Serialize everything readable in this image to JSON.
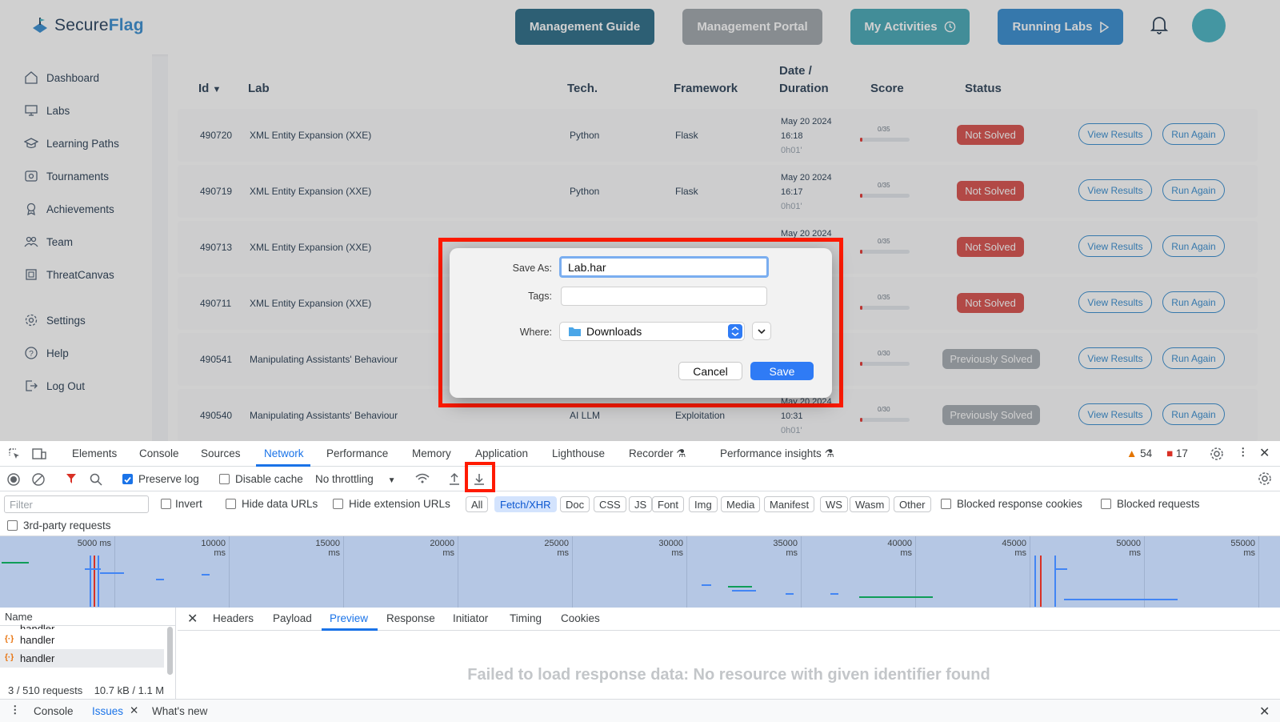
{
  "app": {
    "logo": {
      "part1": "Secure",
      "part2": "Flag"
    },
    "top_buttons": [
      {
        "label": "Management Guide",
        "color": "#2f6f8a"
      },
      {
        "label": "Management Portal",
        "color": "#a2a8ae"
      },
      {
        "label": "My Activities",
        "color": "#4aa9b8"
      },
      {
        "label": "Running Labs",
        "color": "#3a8fd1"
      }
    ],
    "sidebar": [
      {
        "label": "Dashboard",
        "icon": "home-icon"
      },
      {
        "label": "Labs",
        "icon": "monitor-icon"
      },
      {
        "label": "Learning Paths",
        "icon": "graduation-cap-icon"
      },
      {
        "label": "Tournaments",
        "icon": "tournament-icon"
      },
      {
        "label": "Achievements",
        "icon": "medal-icon"
      },
      {
        "label": "Team",
        "icon": "team-icon"
      },
      {
        "label": "ThreatCanvas",
        "icon": "canvas-icon"
      },
      {
        "label": "Settings",
        "icon": "gear-icon"
      },
      {
        "label": "Help",
        "icon": "help-icon"
      },
      {
        "label": "Log Out",
        "icon": "logout-icon"
      }
    ],
    "table": {
      "headers": {
        "id": "Id",
        "lab": "Lab",
        "tech": "Tech.",
        "framework": "Framework",
        "date1": "Date /",
        "date2": "Duration",
        "score": "Score",
        "status": "Status"
      },
      "view_results": "View Results",
      "run_again": "Run Again",
      "rows": [
        {
          "id": "490720",
          "lab": "XML Entity Expansion (XXE)",
          "tech": "Python",
          "framework": "Flask",
          "date": "May 20 2024",
          "time": "16:18",
          "duration": "0h01'",
          "score": "0/35",
          "status": "Not Solved",
          "status_kind": "red"
        },
        {
          "id": "490719",
          "lab": "XML Entity Expansion (XXE)",
          "tech": "Python",
          "framework": "Flask",
          "date": "May 20 2024",
          "time": "16:17",
          "duration": "0h01'",
          "score": "0/35",
          "status": "Not Solved",
          "status_kind": "red"
        },
        {
          "id": "490713",
          "lab": "XML Entity Expansion (XXE)",
          "tech": "",
          "framework": "",
          "date": "May 20 2024",
          "time": "",
          "duration": "",
          "score": "0/35",
          "status": "Not Solved",
          "status_kind": "red"
        },
        {
          "id": "490711",
          "lab": "XML Entity Expansion (XXE)",
          "tech": "",
          "framework": "",
          "date": "",
          "time": "",
          "duration": "",
          "score": "0/35",
          "status": "Not Solved",
          "status_kind": "red"
        },
        {
          "id": "490541",
          "lab": "Manipulating Assistants' Behaviour",
          "tech": "",
          "framework": "",
          "date": "",
          "time": "",
          "duration": "",
          "score": "0/30",
          "status": "Previously Solved",
          "status_kind": "grey"
        },
        {
          "id": "490540",
          "lab": "Manipulating Assistants' Behaviour",
          "tech": "AI LLM",
          "framework": "Exploitation",
          "date": "May 20 2024",
          "time": "10:31",
          "duration": "0h01'",
          "score": "0/30",
          "status": "Previously Solved",
          "status_kind": "grey"
        }
      ]
    }
  },
  "dialog": {
    "save_as_label": "Save As:",
    "save_as_value": "Lab.har",
    "tags_label": "Tags:",
    "where_label": "Where:",
    "where_value": "Downloads",
    "cancel": "Cancel",
    "save": "Save"
  },
  "devtools": {
    "tabs": [
      "Elements",
      "Console",
      "Sources",
      "Network",
      "Performance",
      "Memory",
      "Application",
      "Lighthouse",
      "Recorder",
      "Performance insights"
    ],
    "active_tab": "Network",
    "warnings": "54",
    "errors": "17",
    "toolbar": {
      "preserve_log": "Preserve log",
      "disable_cache": "Disable cache",
      "throttling": "No throttling"
    },
    "filter_placeholder": "Filter",
    "filter_checks": {
      "invert": "Invert",
      "hide_data": "Hide data URLs",
      "hide_ext": "Hide extension URLs",
      "blocked_cookies": "Blocked response cookies",
      "blocked_requests": "Blocked requests"
    },
    "chips": [
      "All",
      "Fetch/XHR",
      "Doc",
      "CSS",
      "JS",
      "Font",
      "Img",
      "Media",
      "Manifest",
      "WS",
      "Wasm",
      "Other"
    ],
    "selected_chip": "Fetch/XHR",
    "third_party": "3rd-party requests",
    "timeline_labels": [
      "5000 ms",
      "10000 ms",
      "15000 ms",
      "20000 ms",
      "25000 ms",
      "30000 ms",
      "35000 ms",
      "40000 ms",
      "45000 ms",
      "50000 ms",
      "55000 ms"
    ],
    "names_header": "Name",
    "names": [
      "handler",
      "handler",
      "handler"
    ],
    "summary": "3 / 510 requests",
    "transfer": "10.7 kB / 1.1 M",
    "detail_tabs": [
      "Headers",
      "Payload",
      "Preview",
      "Response",
      "Initiator",
      "Timing",
      "Cookies"
    ],
    "active_detail": "Preview",
    "failed_msg": "Failed to load response data: No resource with given identifier found",
    "drawer": {
      "console": "Console",
      "issues": "Issues",
      "whats_new": "What's new"
    }
  }
}
